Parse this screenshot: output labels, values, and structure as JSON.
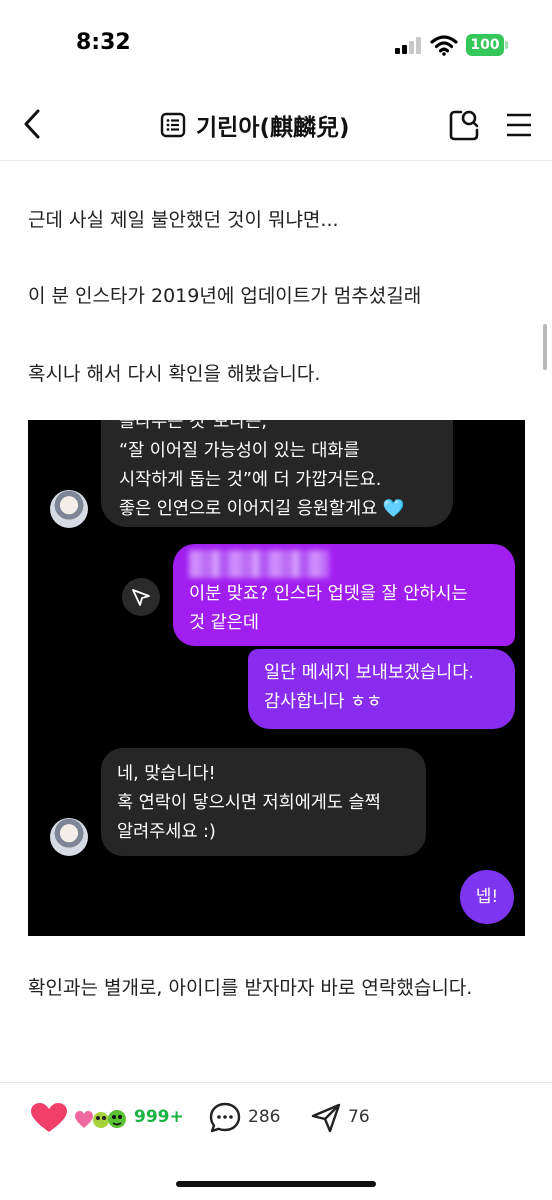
{
  "status_bar": {
    "time": "8:32",
    "battery": "100"
  },
  "header": {
    "title": "기린아(麒麟兒)"
  },
  "article": {
    "paragraphs": [
      "근데 사실 제일 불안했던 것이 뭐냐면...",
      "이 분 인스타가 2019년에 업데이트가 멈추셨길래",
      "혹시나 해서 다시 확인을 해봤습니다."
    ],
    "after_image": "확인과는 별개로, 아이디를 받자마자 바로 연락했습니다."
  },
  "chat": {
    "msg1": [
      "올라주는 것\"보다는,",
      "“잘 이어질 가능성이 있는 대화를",
      "시작하게 돕는 것”에 더 가깝거든요.",
      "좋은 인연으로 이어지길 응원할게요 🩵"
    ],
    "msg2": [
      "이분 맞죠? 인스타 업뎃을 잘 안하시는",
      "것 같은데"
    ],
    "msg3": [
      "일단 메세지 보내보겠습니다.",
      "감사합니다 ㅎㅎ"
    ],
    "msg4": [
      "네, 맞습니다!",
      "혹 연락이 닿으시면 저희에게도 슬쩍",
      "알려주세요 :)"
    ],
    "reply_button": "넵!"
  },
  "bottom_bar": {
    "likes": "999+",
    "comments": "286",
    "shares": "76"
  },
  "colors": {
    "like_green": "#1ab241",
    "bubble_purple": "#a11ef0",
    "bubble_dark": "#262626"
  },
  "icons": [
    "back-arrow-icon",
    "list-icon",
    "search-icon",
    "menu-icon",
    "heart-icon",
    "comment-icon",
    "share-icon",
    "send-icon"
  ]
}
